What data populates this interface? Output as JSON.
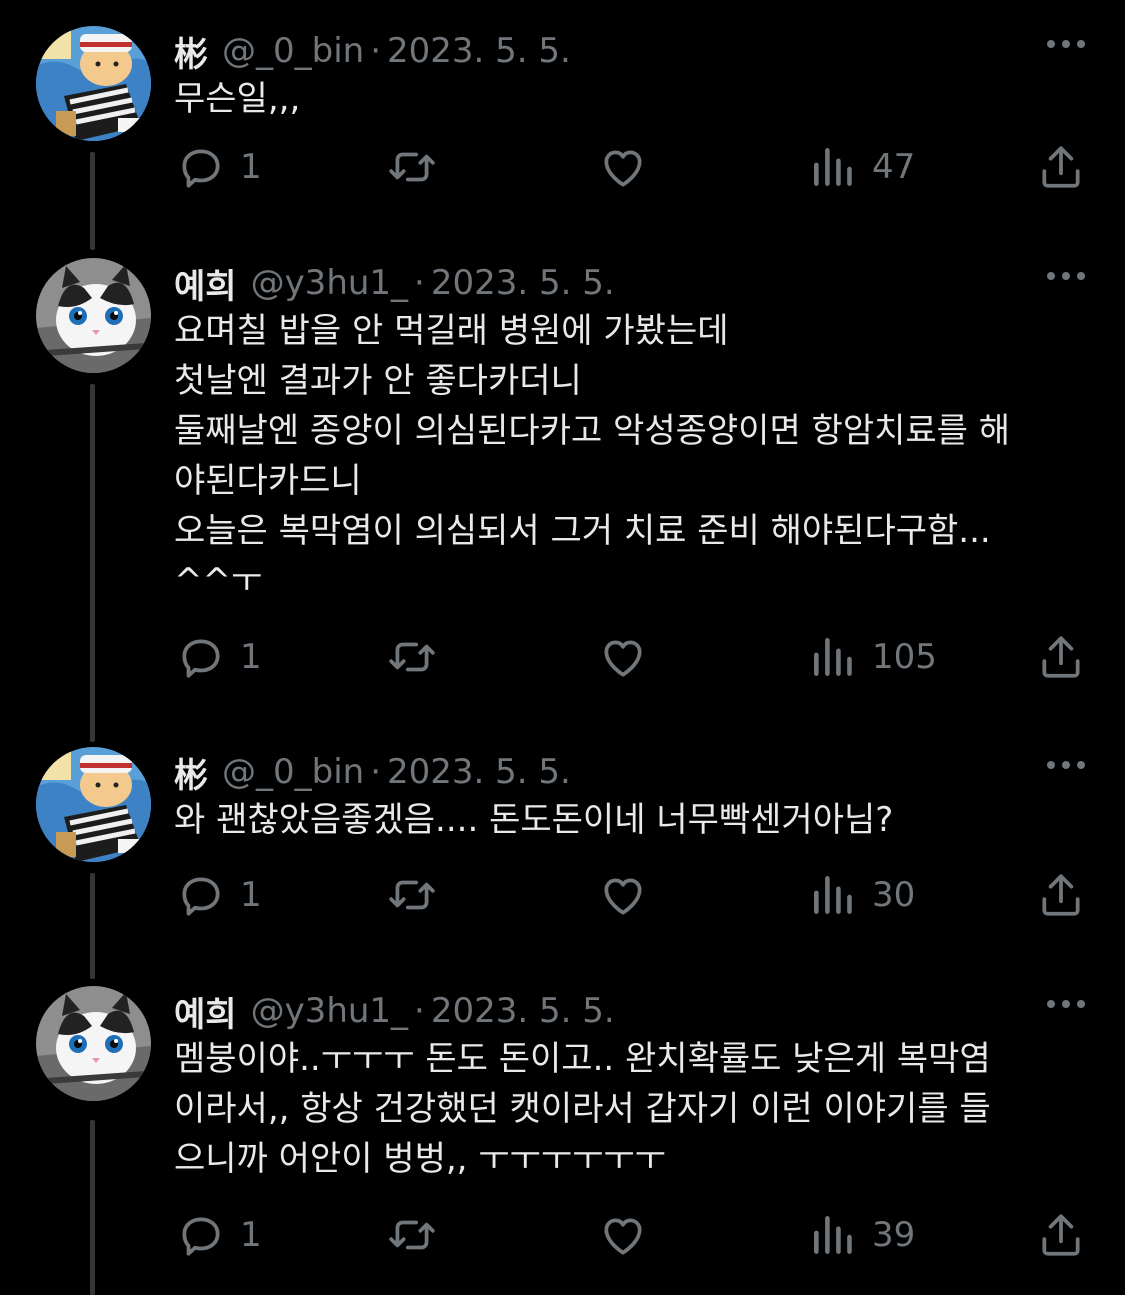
{
  "tweets": [
    {
      "name": "彬",
      "handle": "@_0_bin",
      "date": "2023. 5. 5.",
      "avatar": "cartoon-character-avatar",
      "lines": [
        "무슨일,,,"
      ],
      "replies": "1",
      "retweets": "",
      "likes": "",
      "views": "47"
    },
    {
      "name": "예희",
      "handle": "@y3hu1_",
      "date": "2023. 5. 5.",
      "avatar": "cat-avatar",
      "lines": [
        "요며칠 밥을 안 먹길래 병원에 가봤는데",
        "첫날엔 결과가 안 좋다카더니",
        "둘째날엔 종양이 의심된다카고 악성종양이면 항암치료를 해",
        "야된다카드니",
        "오늘은 복막염이 의심되서 그거 치료 준비 해야된다구함...",
        "^^ㅜ"
      ],
      "replies": "1",
      "retweets": "",
      "likes": "",
      "views": "105"
    },
    {
      "name": "彬",
      "handle": "@_0_bin",
      "date": "2023. 5. 5.",
      "avatar": "cartoon-character-avatar",
      "lines": [
        "와 괜찮았음좋겠음.... 돈도돈이네 너무빡센거아님?"
      ],
      "replies": "1",
      "retweets": "",
      "likes": "",
      "views": "30"
    },
    {
      "name": "예희",
      "handle": "@y3hu1_",
      "date": "2023. 5. 5.",
      "avatar": "cat-avatar",
      "lines": [
        "멤붕이야..ㅜㅜㅜ 돈도 돈이고.. 완치확률도 낮은게 복막염",
        "이라서,, 항상 건강했던 캣이라서 갑자기 이런 이야기를 들",
        "으니까 어안이 벙벙,, ㅜㅜㅜㅜㅜㅜ"
      ],
      "replies": "1",
      "retweets": "",
      "likes": "",
      "views": "39"
    }
  ],
  "icons": {
    "reply": "reply-icon",
    "retweet": "retweet-icon",
    "like": "heart-icon",
    "views": "views-icon",
    "share": "share-icon",
    "more": "more-icon"
  },
  "colors": {
    "background": "#000000",
    "text": "#e7e9ea",
    "secondary": "#71767b",
    "thread_line": "#333639"
  }
}
